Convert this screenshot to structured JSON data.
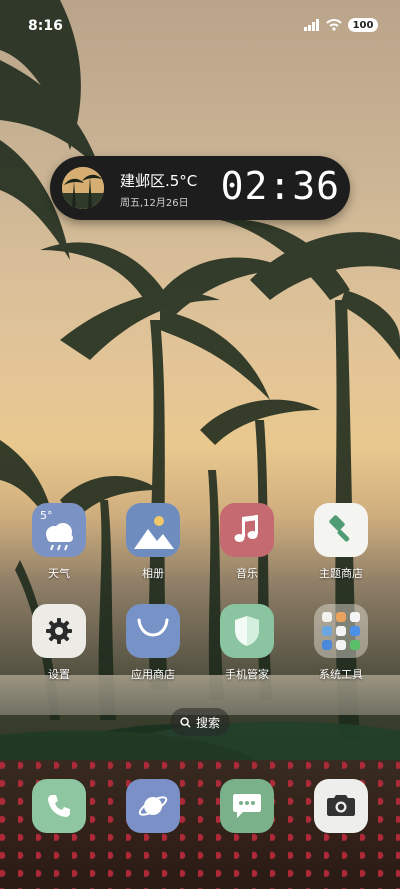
{
  "status_bar": {
    "time": "8:16",
    "battery": "100"
  },
  "widget": {
    "location_temp": "建邺区.5°C",
    "date": "周五,12月26日",
    "clock": "02:36"
  },
  "apps_row1": [
    {
      "label": "天气",
      "temp": "5°"
    },
    {
      "label": "相册"
    },
    {
      "label": "音乐"
    },
    {
      "label": "主题商店"
    }
  ],
  "apps_row2": [
    {
      "label": "设置"
    },
    {
      "label": "应用商店"
    },
    {
      "label": "手机管家"
    },
    {
      "label": "系统工具"
    }
  ],
  "search": {
    "label": "搜索"
  },
  "dock": [
    "phone",
    "browser",
    "messages",
    "camera"
  ]
}
